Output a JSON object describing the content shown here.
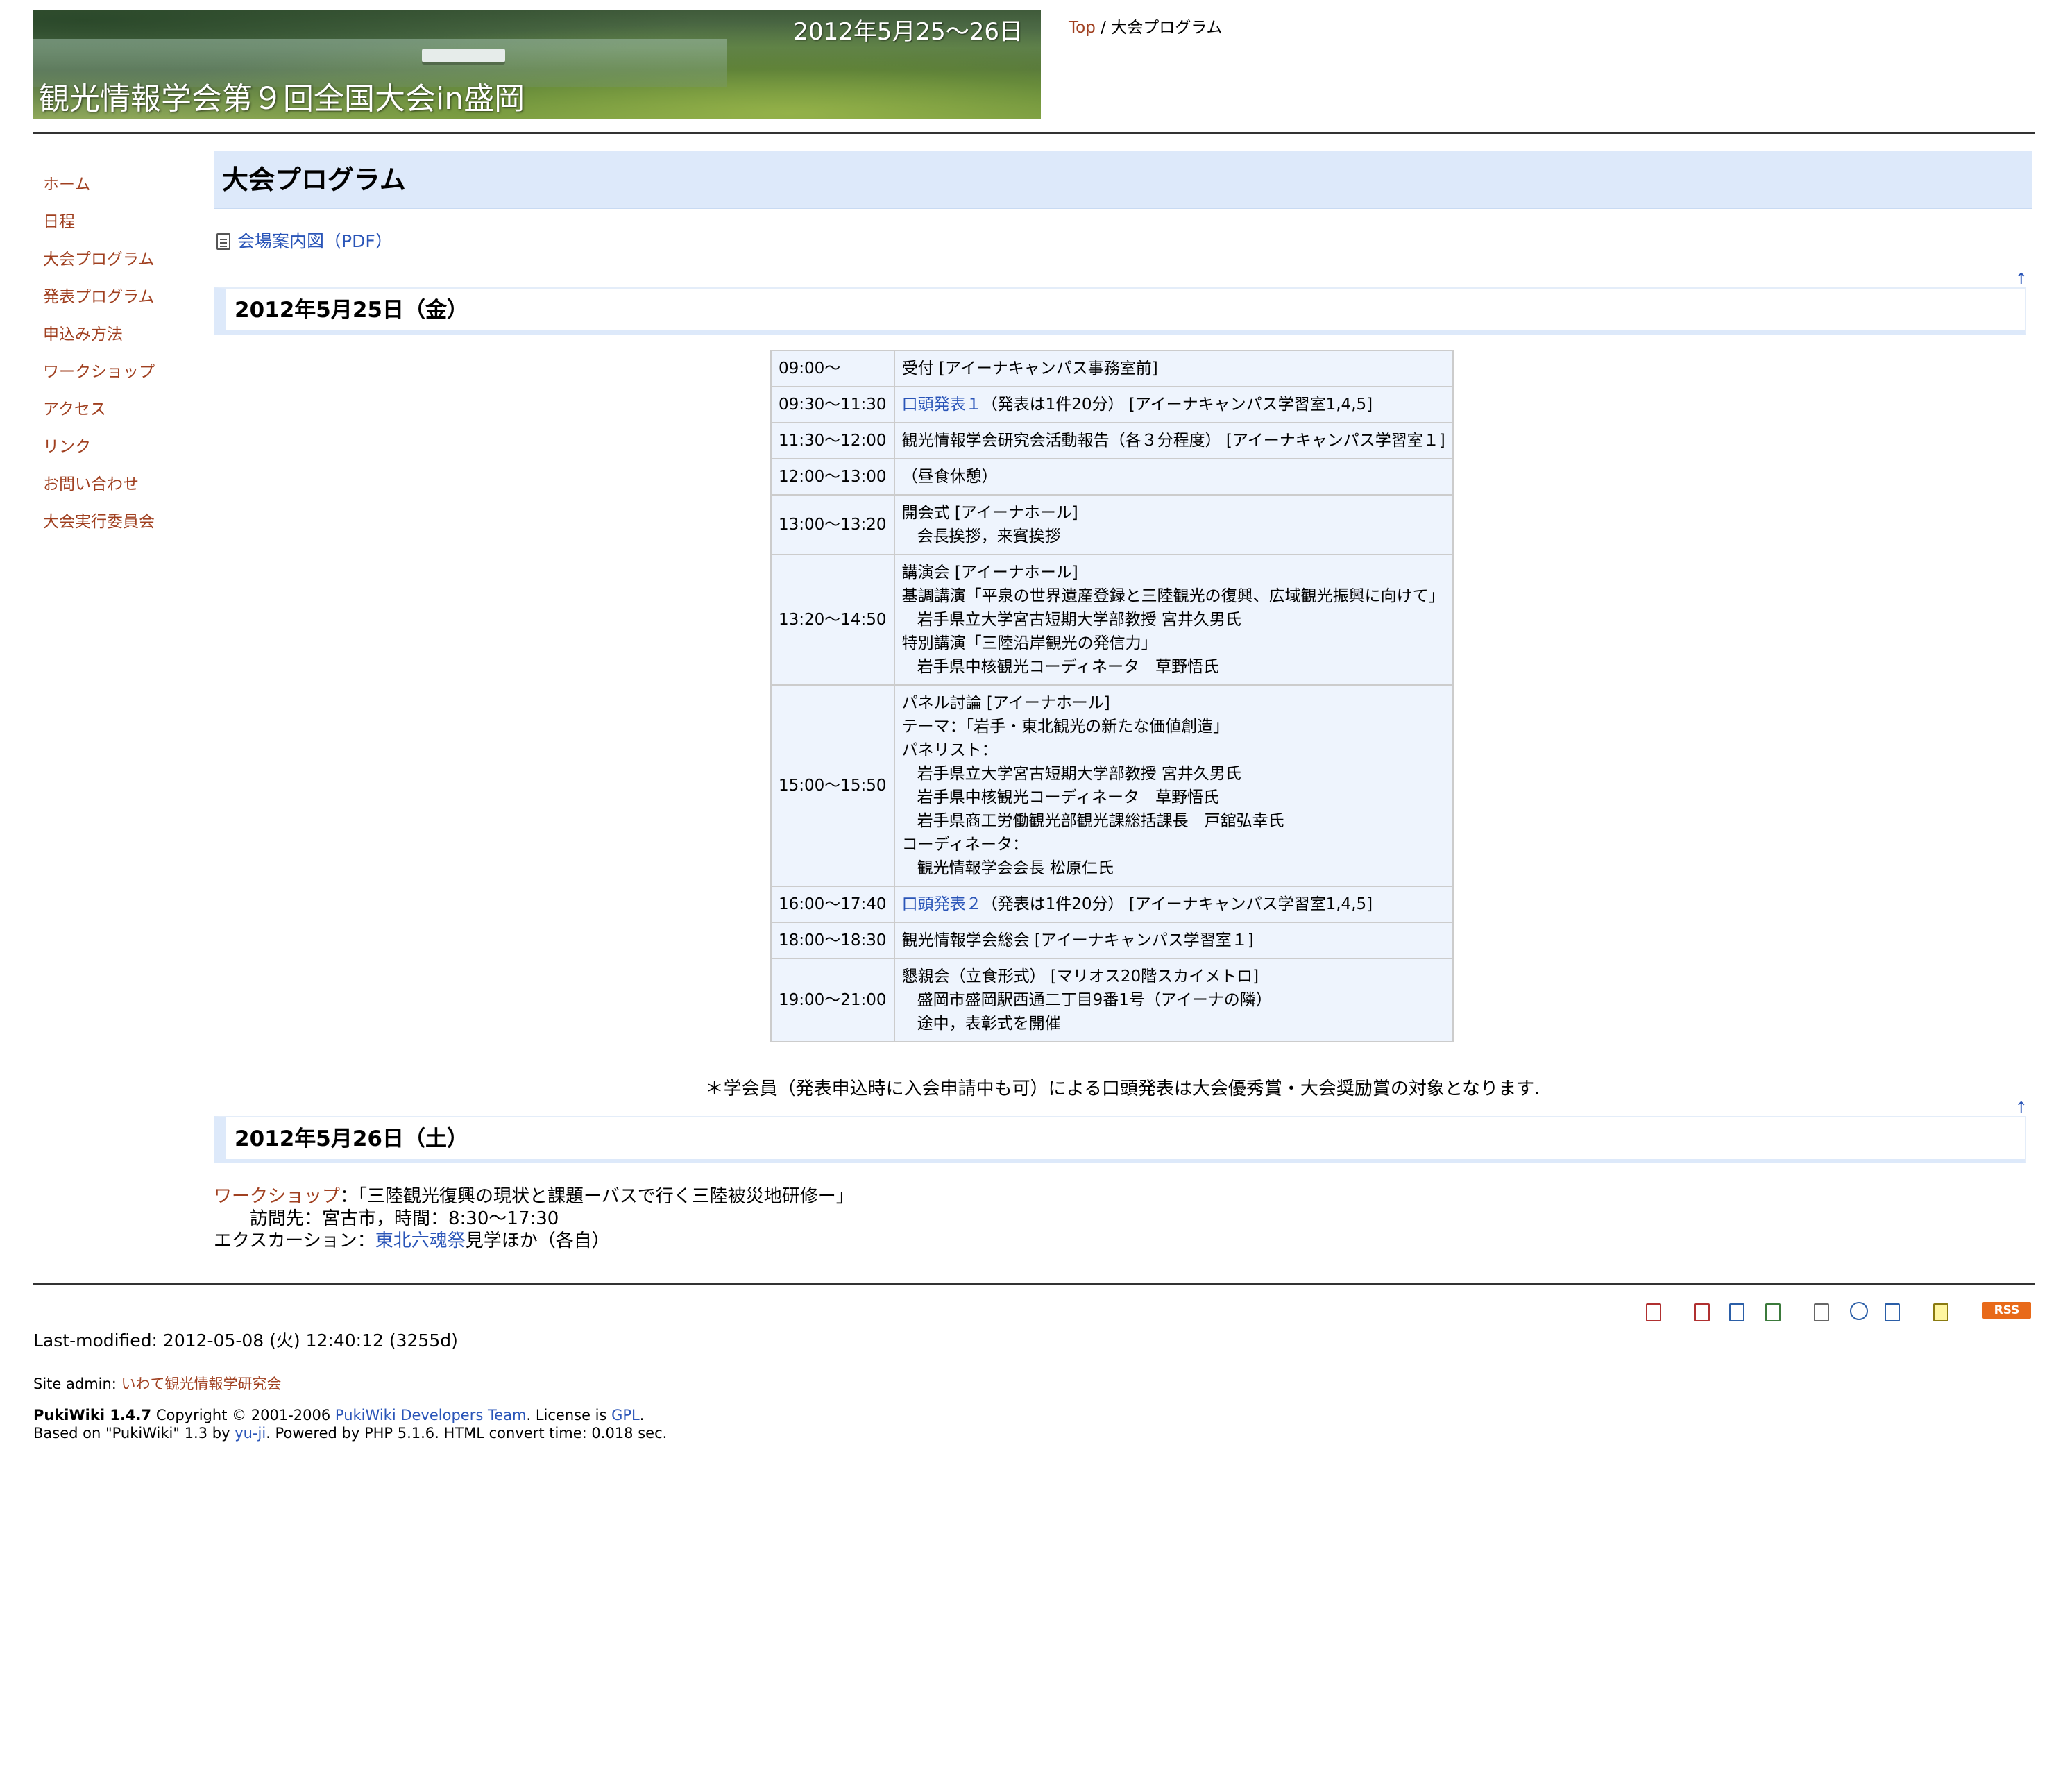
{
  "header": {
    "banner_dates": "2012年5月25〜26日",
    "banner_title": "観光情報学会第９回全国大会in盛岡"
  },
  "topicpath": {
    "top": "Top",
    "sep": " / ",
    "current": "大会プログラム"
  },
  "menu": [
    "ホーム",
    "日程",
    "大会プログラム",
    "発表プログラム",
    "申込み方法",
    "ワークショップ",
    "アクセス",
    "リンク",
    "お問い合わせ",
    "大会実行委員会"
  ],
  "page": {
    "title": "大会プログラム",
    "attachment": "会場案内図（PDF）",
    "jump_arrow": "↑"
  },
  "day1": {
    "heading": "2012年5月25日（金）",
    "rows": [
      {
        "time": "09:00〜",
        "lines": [
          "受付 [アイーナキャンパス事務室前]"
        ]
      },
      {
        "time": "09:30〜11:30",
        "link": "口頭発表１",
        "text": "（発表は1件20分） [アイーナキャンパス学習室1,4,5]"
      },
      {
        "time": "11:30〜12:00",
        "lines": [
          "観光情報学会研究会活動報告（各３分程度） [アイーナキャンパス学習室１]"
        ]
      },
      {
        "time": "12:00〜13:00",
        "lines": [
          "（昼食休憩）"
        ]
      },
      {
        "time": "13:00〜13:20",
        "lines": [
          "開会式 [アイーナホール]",
          "会長挨拶，来賓挨拶"
        ]
      },
      {
        "time": "13:20〜14:50",
        "lines": [
          "講演会 [アイーナホール]",
          "基調講演「平泉の世界遺産登録と三陸観光の復興、広域観光振興に向けて」",
          "岩手県立大学宮古短期大学部教授 宮井久男氏",
          "特別講演「三陸沿岸観光の発信力」",
          "岩手県中核観光コーディネータ　草野悟氏"
        ]
      },
      {
        "time": "15:00〜15:50",
        "lines": [
          "パネル討論 [アイーナホール]",
          "テーマ：「岩手・東北観光の新たな価値創造」",
          "パネリスト：",
          "岩手県立大学宮古短期大学部教授 宮井久男氏",
          "岩手県中核観光コーディネータ　草野悟氏",
          "岩手県商工労働観光部観光課総括課長　戸舘弘幸氏",
          "コーディネータ：",
          "観光情報学会会長 松原仁氏"
        ]
      },
      {
        "time": "16:00〜17:40",
        "link": "口頭発表２",
        "text": "（発表は1件20分） [アイーナキャンパス学習室1,4,5]"
      },
      {
        "time": "18:00〜18:30",
        "lines": [
          "観光情報学会総会 [アイーナキャンパス学習室１]"
        ]
      },
      {
        "time": "19:00〜21:00",
        "lines": [
          "懇親会（立食形式） [マリオス20階スカイメトロ]",
          "盛岡市盛岡駅西通二丁目9番1号（アイーナの隣）",
          "途中，表彰式を開催"
        ]
      }
    ],
    "note": "＊学会員（発表申込時に入会申請中も可）による口頭発表は大会優秀賞・大会奨励賞の対象となります."
  },
  "day2": {
    "heading": "2012年5月26日（土）",
    "workshop_link": "ワークショップ",
    "workshop_text": "：「三陸観光復興の現状と課題ーバスで行く三陸被災地研修ー」",
    "visit": "訪問先：宮古市，時間：8:30〜17:30",
    "excursion_label": "エクスカーション：",
    "excursion_link": "東北六魂祭",
    "excursion_text": "見学ほか（各自）"
  },
  "footer": {
    "rss": "RSS",
    "last_modified": "Last-modified: 2012-05-08 (火) 12:40:12 (3255d)",
    "site_admin_label": "Site admin: ",
    "site_admin_link": "いわて観光情報学研究会",
    "credits_pukiwiki": "PukiWiki 1.4.7",
    "credits_copy": " Copyright © 2001-2006 ",
    "credits_team": "PukiWiki Developers Team",
    "credits_license": ". License is ",
    "credits_gpl": "GPL",
    "credits_dot": ".",
    "credits_based": "Based on \"PukiWiki\" 1.3 by ",
    "credits_yuji": "yu-ji",
    "credits_powered": ". Powered by PHP 5.1.6. HTML convert time: 0.018 sec."
  }
}
